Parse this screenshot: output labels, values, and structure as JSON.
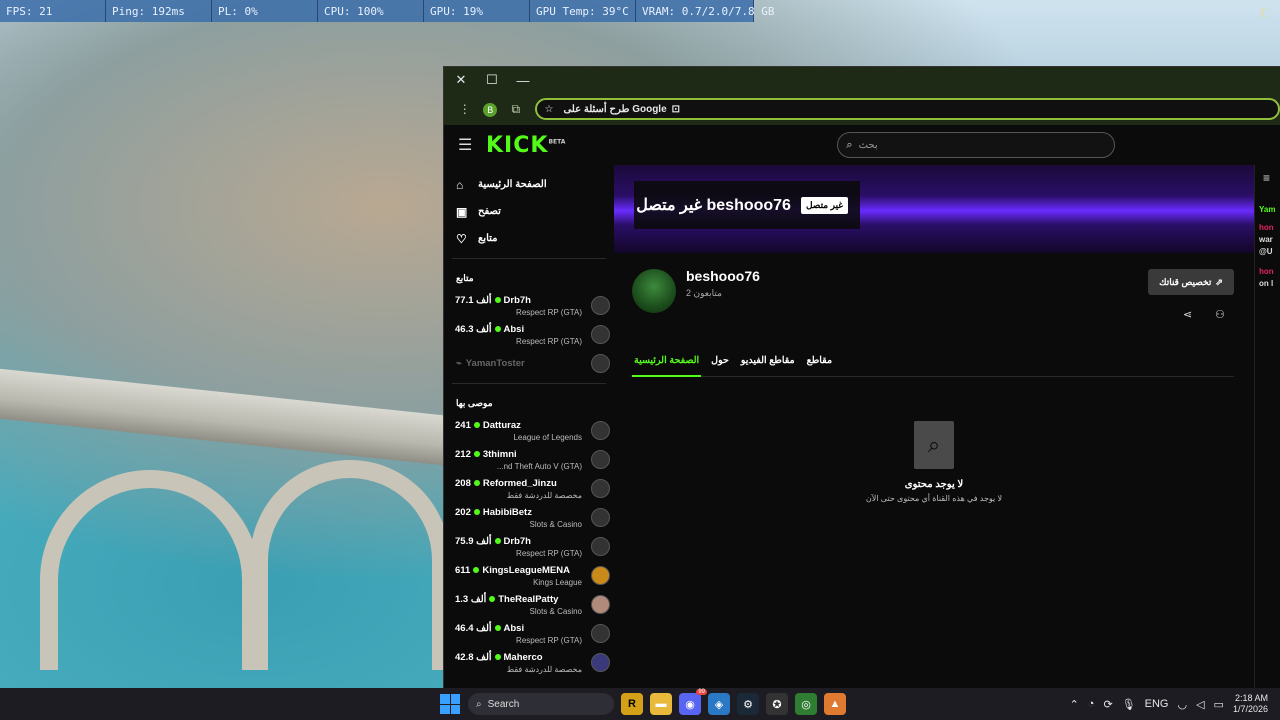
{
  "hud": {
    "fps": "FPS: 21",
    "ping": "Ping: 192ms",
    "pl": "PL: 0%",
    "cpu": "CPU: 100%",
    "gpu": "GPU: 19%",
    "gpu_temp": "GPU Temp: 39°C",
    "vram": "VRAM: 0.7/2.0/7.8 GB"
  },
  "browser": {
    "profile_letter": "B",
    "omnibox_text": "طرح أسئلة على Google"
  },
  "kick": {
    "logo": "KICK",
    "logo_badge": "BETA",
    "search_placeholder": "بحث",
    "nav": [
      {
        "label": "الصفحة الرئيسية",
        "icon": "home-icon",
        "glyph": "⌂"
      },
      {
        "label": "تصفح",
        "icon": "browse-icon",
        "glyph": "▣"
      },
      {
        "label": "متابع",
        "icon": "heart-icon",
        "glyph": "♡"
      }
    ],
    "following_title": "متابع",
    "following": [
      {
        "count": "77.1 ألف",
        "name": "Drb7h",
        "category": "Respect RP (GTA)"
      },
      {
        "count": "46.3 ألف",
        "name": "Absi",
        "category": "Respect RP (GTA)"
      }
    ],
    "offline_channel": "YamanToster",
    "recommended_title": "موصى بها",
    "recommended": [
      {
        "count": "241",
        "name": "Datturaz",
        "category": "League of Legends"
      },
      {
        "count": "212",
        "name": "3thimni",
        "category": "...nd Theft Auto V (GTA)"
      },
      {
        "count": "208",
        "name": "Reformed_Jinzu",
        "category": "مخصصة للدردشة فقط"
      },
      {
        "count": "202",
        "name": "HabibiBetz",
        "category": "Slots & Casino"
      },
      {
        "count": "75.9 ألف",
        "name": "Drb7h",
        "category": "Respect RP (GTA)"
      },
      {
        "count": "611",
        "name": "KingsLeagueMENA",
        "category": "Kings League"
      },
      {
        "count": "1.3 ألف",
        "name": "TheRealPatty",
        "category": "Slots & Casino"
      },
      {
        "count": "46.4 ألف",
        "name": "Absi",
        "category": "Respect RP (GTA)"
      },
      {
        "count": "42.8 ألف",
        "name": "Maherco",
        "category": "مخصصة للدردشة فقط"
      }
    ],
    "banner_title": "غير متصل beshooo76",
    "offline_badge": "غير متصل",
    "channel_name": "beshooo76",
    "followers": "2 متابعون",
    "customize_label": "تخصيص قناتك",
    "tabs": [
      "الصفحة الرئيسية",
      "حول",
      "مقاطع الفيديو",
      "مقاطع"
    ],
    "empty_title": "لا يوجد محتوى",
    "empty_subtitle": "لا يوجد في هذه القناة أي محتوى حتى الآن",
    "chat_fragments": [
      "Yam",
      "hon",
      "war",
      "@U",
      "hon",
      "on l"
    ]
  },
  "taskbar": {
    "search_label": "Search",
    "lang": "ENG",
    "time": "2:18 AM",
    "date": "1/7/2026",
    "chat_badge": "99"
  },
  "colors": {
    "kick_green": "#53fc18",
    "hud_blue": "#3c6eaa"
  }
}
